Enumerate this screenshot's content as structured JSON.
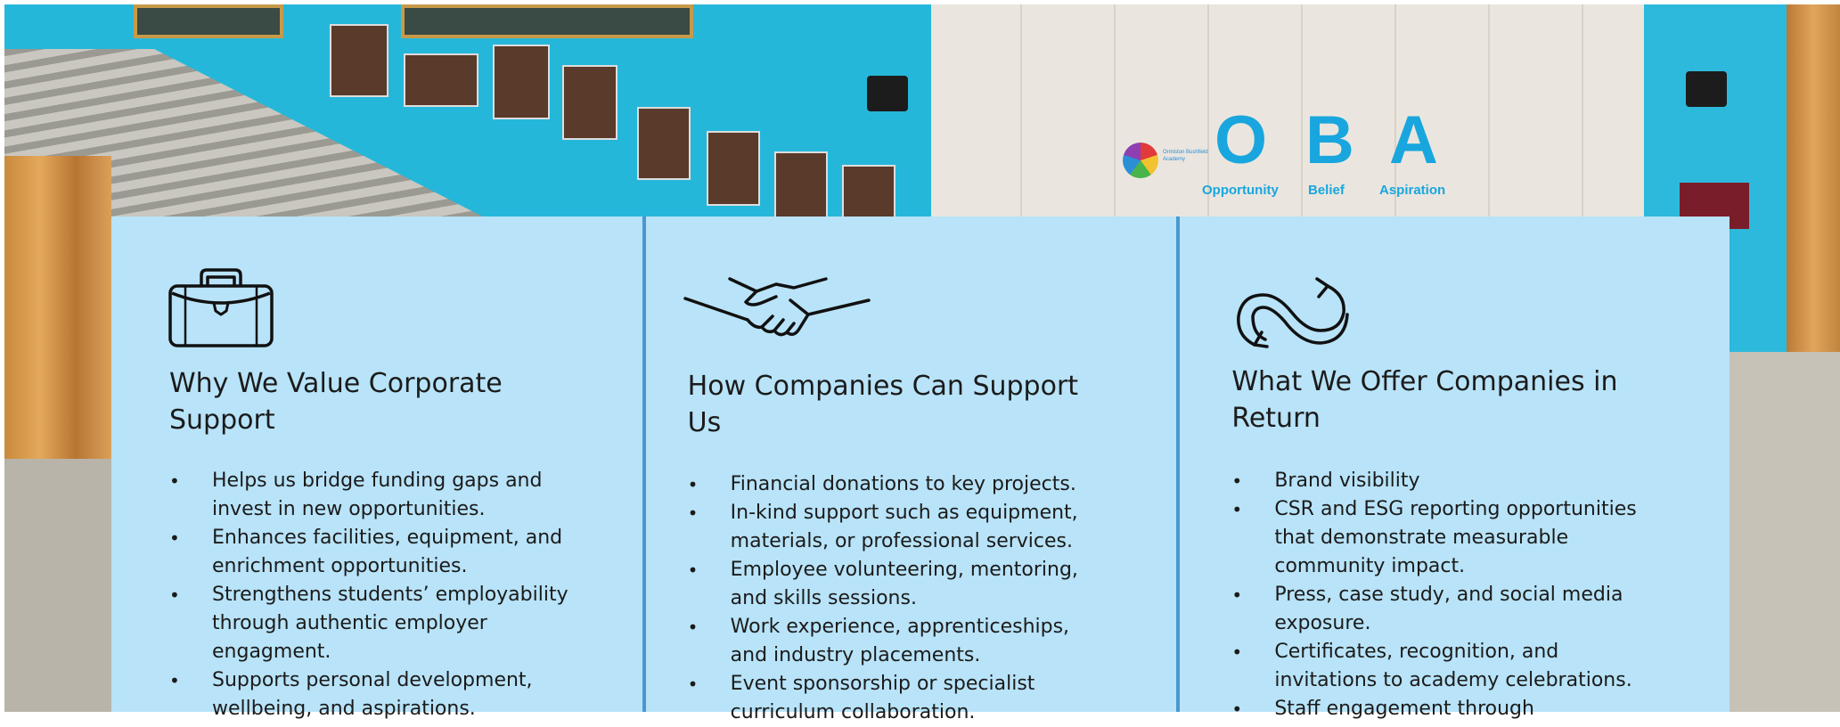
{
  "background": {
    "signage": {
      "school_name": "Ormiston Bushfield Academy",
      "letters": [
        "O",
        "B",
        "A"
      ],
      "words": [
        "Opportunity",
        "Belief",
        "Aspiration"
      ]
    }
  },
  "cards": [
    {
      "icon": "briefcase-icon",
      "title": "Why We Value Corporate Support",
      "items": [
        "Helps us bridge funding gaps and invest in new opportunities.",
        "Enhances facilities, equipment, and enrichment opportunities.",
        "Strengthens students’ employability through authentic employer engagment.",
        "Supports personal development, wellbeing, and aspirations."
      ]
    },
    {
      "icon": "handshake-icon",
      "title": "How Companies Can Support Us",
      "items": [
        "Financial donations to key projects.",
        "In-kind support such as equipment, materials, or professional services.",
        "Employee volunteering, mentoring, and skills sessions.",
        "Work experience, apprenticeships, and industry placements.",
        "Event sponsorship or specialist curriculum collaboration."
      ]
    },
    {
      "icon": "exchange-arrows-icon",
      "title": "What We Offer Companies in Return",
      "items": [
        "Brand visibility",
        "CSR and ESG reporting opportunities that demonstrate measurable community impact.",
        "Press, case study, and social media exposure.",
        "Certificates, recognition, and invitations to academy celebrations.",
        "Staff engagement through"
      ]
    }
  ],
  "colors": {
    "card_background": "#b8e3f8",
    "separator": "#4a98d1",
    "wall_blue": "#25b7da",
    "text": "#1b1b1b"
  }
}
